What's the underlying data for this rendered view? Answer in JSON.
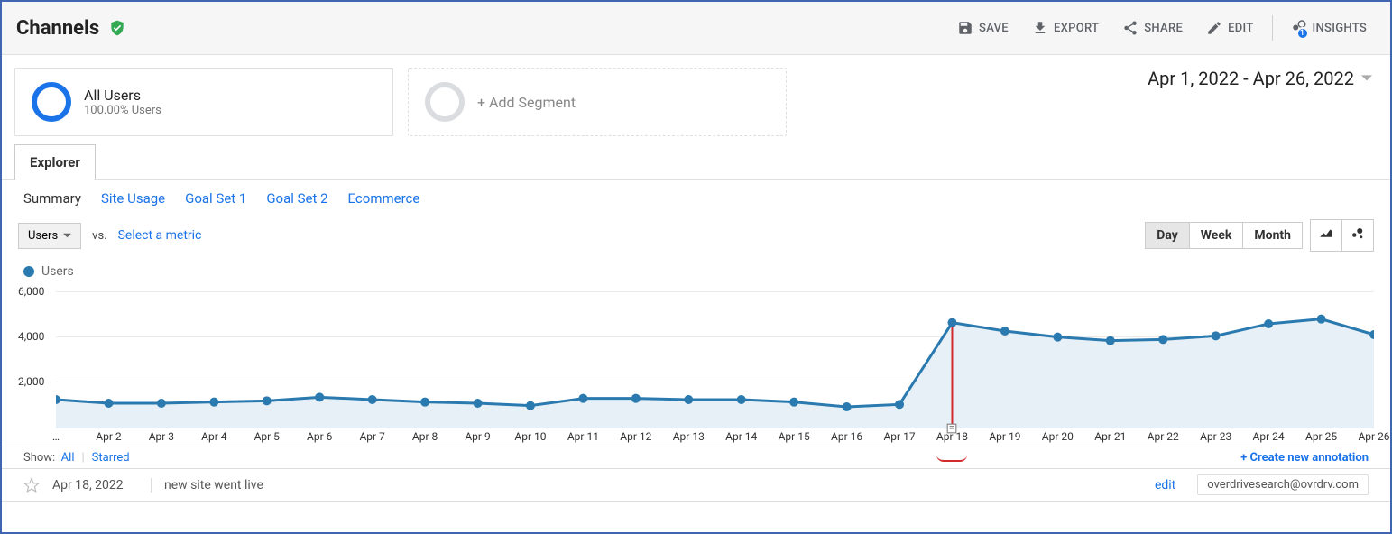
{
  "page_title": "Channels",
  "actions": {
    "save": "SAVE",
    "export": "EXPORT",
    "share": "SHARE",
    "edit": "EDIT",
    "insights": "INSIGHTS",
    "insights_badge": "1"
  },
  "segments": {
    "primary": {
      "label": "All Users",
      "sub": "100.00% Users"
    },
    "add": {
      "label": "+ Add Segment"
    }
  },
  "date_range": "Apr 1, 2022 - Apr 26, 2022",
  "tabs": {
    "explorer": "Explorer"
  },
  "subtabs": {
    "summary": "Summary",
    "site_usage": "Site Usage",
    "goal1": "Goal Set 1",
    "goal2": "Goal Set 2",
    "ecommerce": "Ecommerce"
  },
  "metric_selector": "Users",
  "vs": "vs.",
  "select_metric": "Select a metric",
  "granularity": {
    "day": "Day",
    "week": "Week",
    "month": "Month"
  },
  "legend": "Users",
  "y_ticks": {
    "t2000": "2,000",
    "t4000": "4,000",
    "t6000": "6,000"
  },
  "x_ticks": [
    "…",
    "Apr 2",
    "Apr 3",
    "Apr 4",
    "Apr 5",
    "Apr 6",
    "Apr 7",
    "Apr 8",
    "Apr 9",
    "Apr 10",
    "Apr 11",
    "Apr 12",
    "Apr 13",
    "Apr 14",
    "Apr 15",
    "Apr 16",
    "Apr 17",
    "Apr 18",
    "Apr 19",
    "Apr 20",
    "Apr 21",
    "Apr 22",
    "Apr 23",
    "Apr 24",
    "Apr 25",
    "Apr 26"
  ],
  "annotation_filter": {
    "show_label": "Show:",
    "all": "All",
    "starred": "Starred",
    "create": "+ Create new annotation"
  },
  "annotation": {
    "date": "Apr 18, 2022",
    "text": "new site went live",
    "edit": "edit",
    "email": "overdrivesearch@ovrdrv.com"
  },
  "chart_data": {
    "type": "line",
    "xlabel": "",
    "ylabel": "Users",
    "ylim": [
      0,
      6000
    ],
    "x": [
      "Apr 1",
      "Apr 2",
      "Apr 3",
      "Apr 4",
      "Apr 5",
      "Apr 6",
      "Apr 7",
      "Apr 8",
      "Apr 9",
      "Apr 10",
      "Apr 11",
      "Apr 12",
      "Apr 13",
      "Apr 14",
      "Apr 15",
      "Apr 16",
      "Apr 17",
      "Apr 18",
      "Apr 19",
      "Apr 20",
      "Apr 21",
      "Apr 22",
      "Apr 23",
      "Apr 24",
      "Apr 25",
      "Apr 26"
    ],
    "series": [
      {
        "name": "Users",
        "color": "#2a7ab0",
        "values": [
          1200,
          1050,
          1050,
          1100,
          1150,
          1300,
          1200,
          1100,
          1050,
          950,
          1250,
          1250,
          1200,
          1200,
          1100,
          900,
          1000,
          4400,
          4050,
          3800,
          3650,
          3700,
          3850,
          4350,
          4550,
          3900
        ]
      }
    ],
    "annotation_date": "Apr 18",
    "annotation_text": "new site went live",
    "highlight": "Apr 18"
  }
}
